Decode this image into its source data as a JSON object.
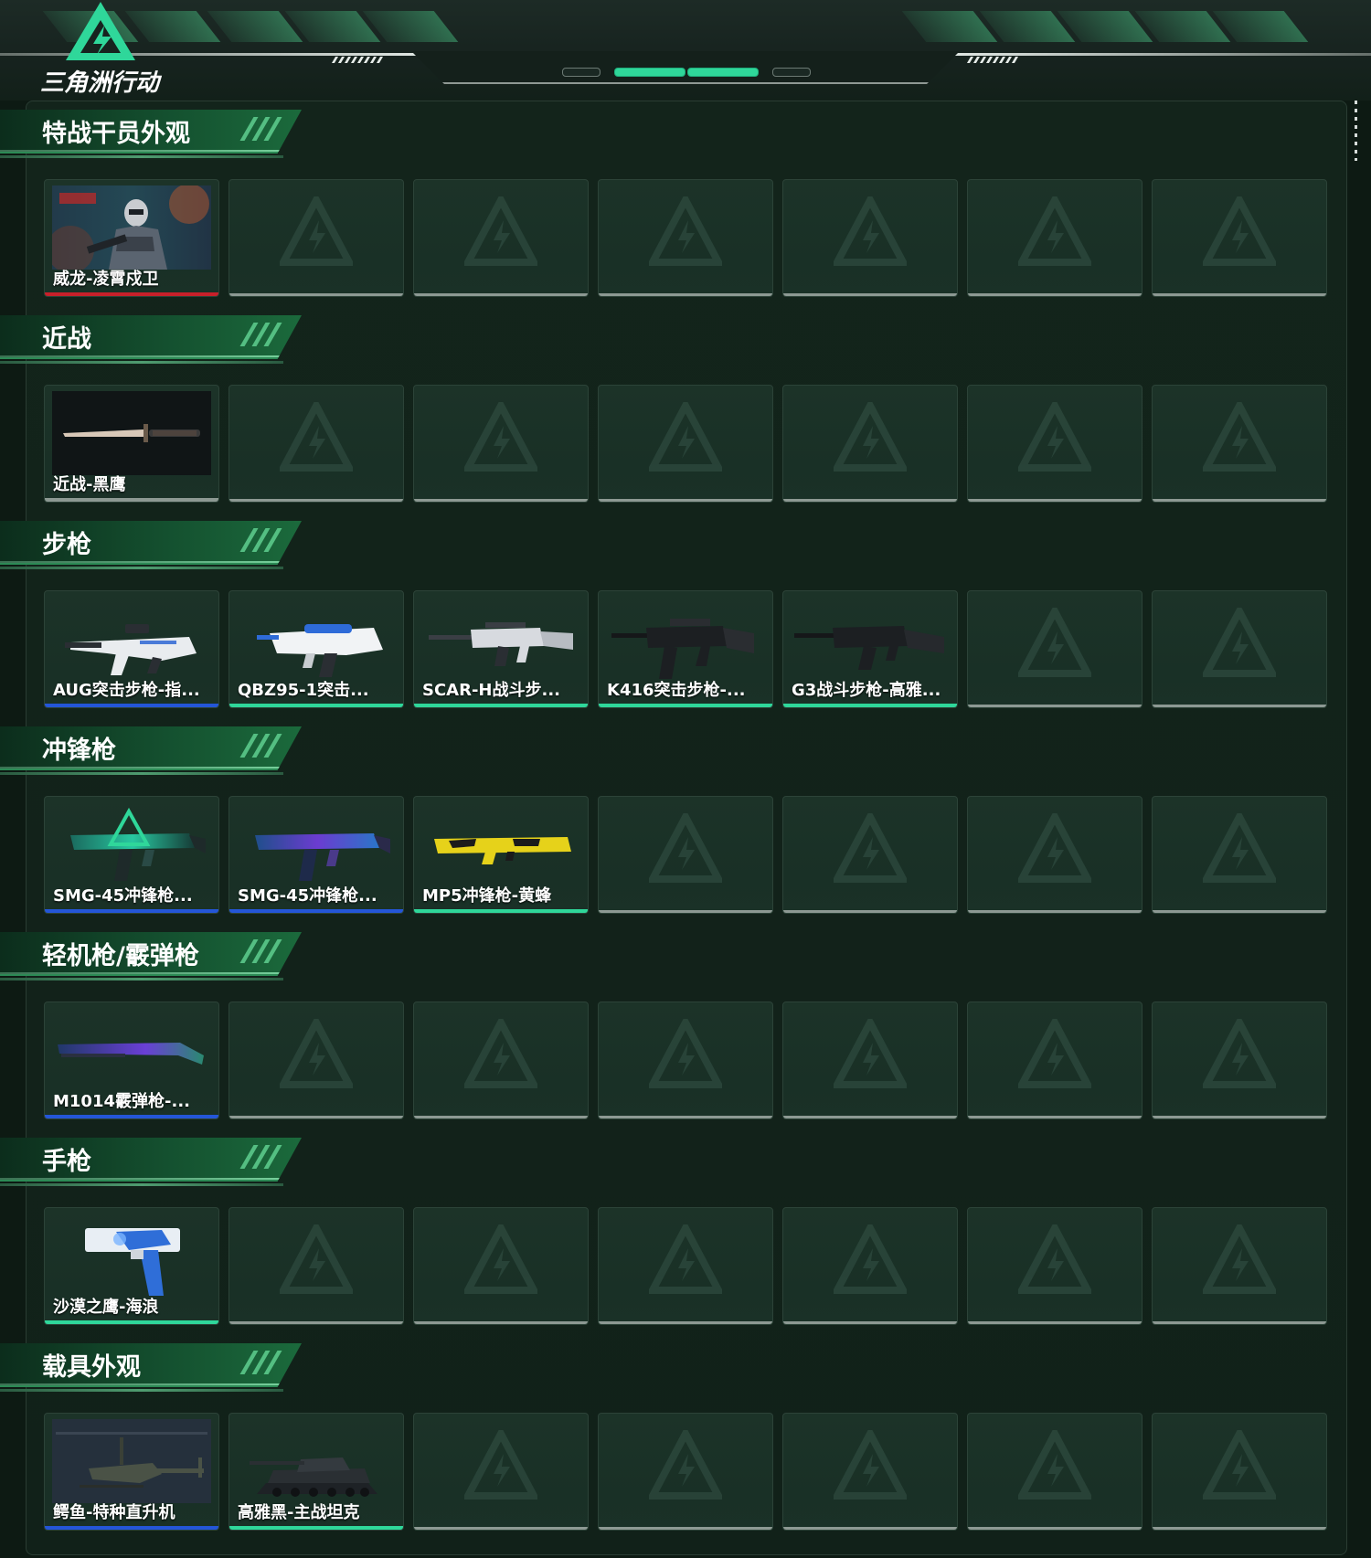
{
  "header": {
    "logo_text": "三角洲行动",
    "logo_icon": "delta-force-triangle-icon"
  },
  "colors": {
    "rarity_red": "#c8202a",
    "rarity_blue": "#2456d8",
    "rarity_green": "#2fd79a",
    "rarity_gray": "#8d9993",
    "accent": "#2fd79a"
  },
  "sections": [
    {
      "title": "特战干员外观",
      "items": [
        {
          "label": "威龙-凌霄戍卫",
          "rarity": "red",
          "art": "operator"
        }
      ]
    },
    {
      "title": "近战",
      "items": [
        {
          "label": "近战-黑鹰",
          "rarity": "gray",
          "art": "knife"
        }
      ]
    },
    {
      "title": "步枪",
      "items": [
        {
          "label": "AUG突击步枪-指...",
          "rarity": "blue",
          "art": "bullpup"
        },
        {
          "label": "QBZ95-1突击...",
          "rarity": "green",
          "art": "qbz"
        },
        {
          "label": "SCAR-H战斗步...",
          "rarity": "green",
          "art": "rifle-white"
        },
        {
          "label": "K416突击步枪-...",
          "rarity": "green",
          "art": "rifle-black"
        },
        {
          "label": "G3战斗步枪-高雅...",
          "rarity": "green",
          "art": "rifle-black-long"
        }
      ]
    },
    {
      "title": "冲锋枪",
      "items": [
        {
          "label": "SMG-45冲锋枪...",
          "rarity": "blue",
          "art": "smg-teal"
        },
        {
          "label": "SMG-45冲锋枪...",
          "rarity": "blue",
          "art": "smg-purple"
        },
        {
          "label": "MP5冲锋枪-黄蜂",
          "rarity": "green",
          "art": "smg-yellow"
        }
      ]
    },
    {
      "title": "轻机枪/霰弹枪",
      "items": [
        {
          "label": "M1014霰弹枪-...",
          "rarity": "blue",
          "art": "shotgun"
        }
      ]
    },
    {
      "title": "手枪",
      "items": [
        {
          "label": "沙漠之鹰-海浪",
          "rarity": "green",
          "art": "pistol"
        }
      ]
    },
    {
      "title": "载具外观",
      "items": [
        {
          "label": "鳄鱼-特种直升机",
          "rarity": "blue",
          "art": "helicopter"
        },
        {
          "label": "高雅黑-主战坦克",
          "rarity": "green",
          "art": "tank"
        }
      ]
    }
  ]
}
